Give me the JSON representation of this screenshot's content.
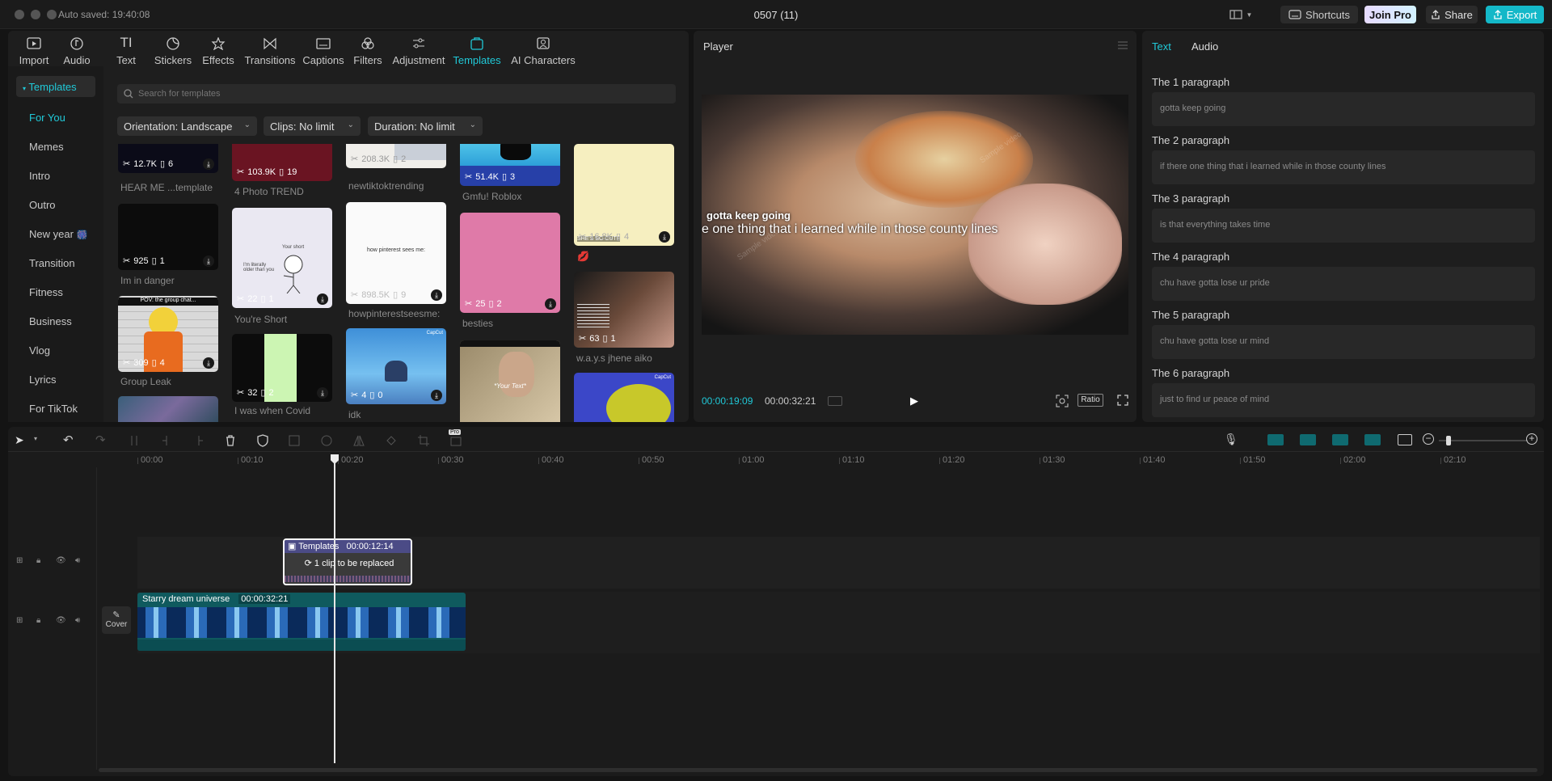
{
  "titlebar": {
    "autosave": "Auto saved: 19:40:08",
    "project_title": "0507 (11)",
    "shortcuts_label": "Shortcuts",
    "join_pro_label": "Join Pro",
    "share_label": "Share",
    "export_label": "Export"
  },
  "toolbar": {
    "items": [
      "Import",
      "Audio",
      "Text",
      "Stickers",
      "Effects",
      "Transitions",
      "Captions",
      "Filters",
      "Adjustment",
      "Templates",
      "AI Characters"
    ],
    "active": "Templates"
  },
  "sidebar": {
    "header": "Templates",
    "categories": [
      "For You",
      "Memes",
      "Intro",
      "Outro",
      "New year",
      "Transition",
      "Fitness",
      "Business",
      "Vlog",
      "Lyrics",
      "For TikTok"
    ],
    "selected": "For You"
  },
  "search": {
    "placeholder": "Search for templates"
  },
  "filters": {
    "orientation": "Orientation: Landscape",
    "clips": "Clips: No limit",
    "duration": "Duration: No limit"
  },
  "templates": [
    {
      "name": "HEAR ME ...template",
      "uses": "12.7K",
      "clips": "6"
    },
    {
      "name": "Im in danger",
      "uses": "925",
      "clips": "1"
    },
    {
      "name": "Group Leak",
      "uses": "309",
      "clips": "4"
    },
    {
      "name": "4 Photo TREND",
      "uses": "103.9K",
      "clips": "19"
    },
    {
      "name": "You're Short",
      "uses": "22",
      "clips": "1"
    },
    {
      "name": "I was when Covid",
      "uses": "32",
      "clips": "2"
    },
    {
      "name": "newtiktoktrending",
      "uses": "208.3K",
      "clips": "2"
    },
    {
      "name": "howpinterestseesme:",
      "uses": "898.5K",
      "clips": "9"
    },
    {
      "name": "idk",
      "uses": "4",
      "clips": "0"
    },
    {
      "name": "Gmfu! Roblox",
      "uses": "51.4K",
      "clips": "3"
    },
    {
      "name": "besties",
      "uses": "25",
      "clips": "2"
    },
    {
      "name": "",
      "uses": "16.8K",
      "clips": "4"
    },
    {
      "name": "w.a.y.s jhene aiko",
      "uses": "63",
      "clips": "1"
    }
  ],
  "card_texts": {
    "pinterest": "how pinterest sees me:",
    "short": "Your short",
    "short2": "I'm literally older than you",
    "your_text": "*Your Text*",
    "cute": "SHE'S SO CUTE",
    "capcut": "CapCut"
  },
  "player": {
    "title": "Player",
    "current_time": "00:00:19:09",
    "total_time": "00:00:32:21",
    "ratio_label": "Ratio",
    "caption_line1": "gotta keep going",
    "caption_line2": "e one thing that i learned while in those county lines",
    "watermark": "Sample video"
  },
  "right_panel": {
    "tabs": [
      "Text",
      "Audio"
    ],
    "active_tab": "Text",
    "paragraphs": [
      {
        "label": "The 1 paragraph",
        "text": "gotta keep going"
      },
      {
        "label": "The 2 paragraph",
        "text": "if there one thing that i learned while in those county lines"
      },
      {
        "label": "The 3 paragraph",
        "text": "is that everything takes time"
      },
      {
        "label": "The 4 paragraph",
        "text": "chu have gotta lose ur pride"
      },
      {
        "label": "The 5 paragraph",
        "text": "chu have gotta lose ur mind"
      },
      {
        "label": "The 6 paragraph",
        "text": "just to find ur peace of mind"
      }
    ]
  },
  "timeline": {
    "ticks": [
      "00:00",
      "00:10",
      "00:20",
      "00:30",
      "00:40",
      "00:50",
      "01:00",
      "01:10",
      "01:20",
      "01:30",
      "01:40",
      "01:50",
      "02:00",
      "02:10"
    ],
    "template_clip": {
      "label": "Templates",
      "duration": "00:00:12:14",
      "replace_text": "1 clip to be replaced"
    },
    "main_clip": {
      "label": "Starry dream universe",
      "duration": "00:00:32:21"
    },
    "cover_label": "Cover",
    "pro_badge": "Pro",
    "playhead_time": "00:00:19:09"
  },
  "colors": {
    "accent": "#20c9d8",
    "bg": "#141414",
    "panel": "#1e1e1e",
    "clip_teal": "#0f5a5e",
    "template_clip": "#4b4b86"
  }
}
